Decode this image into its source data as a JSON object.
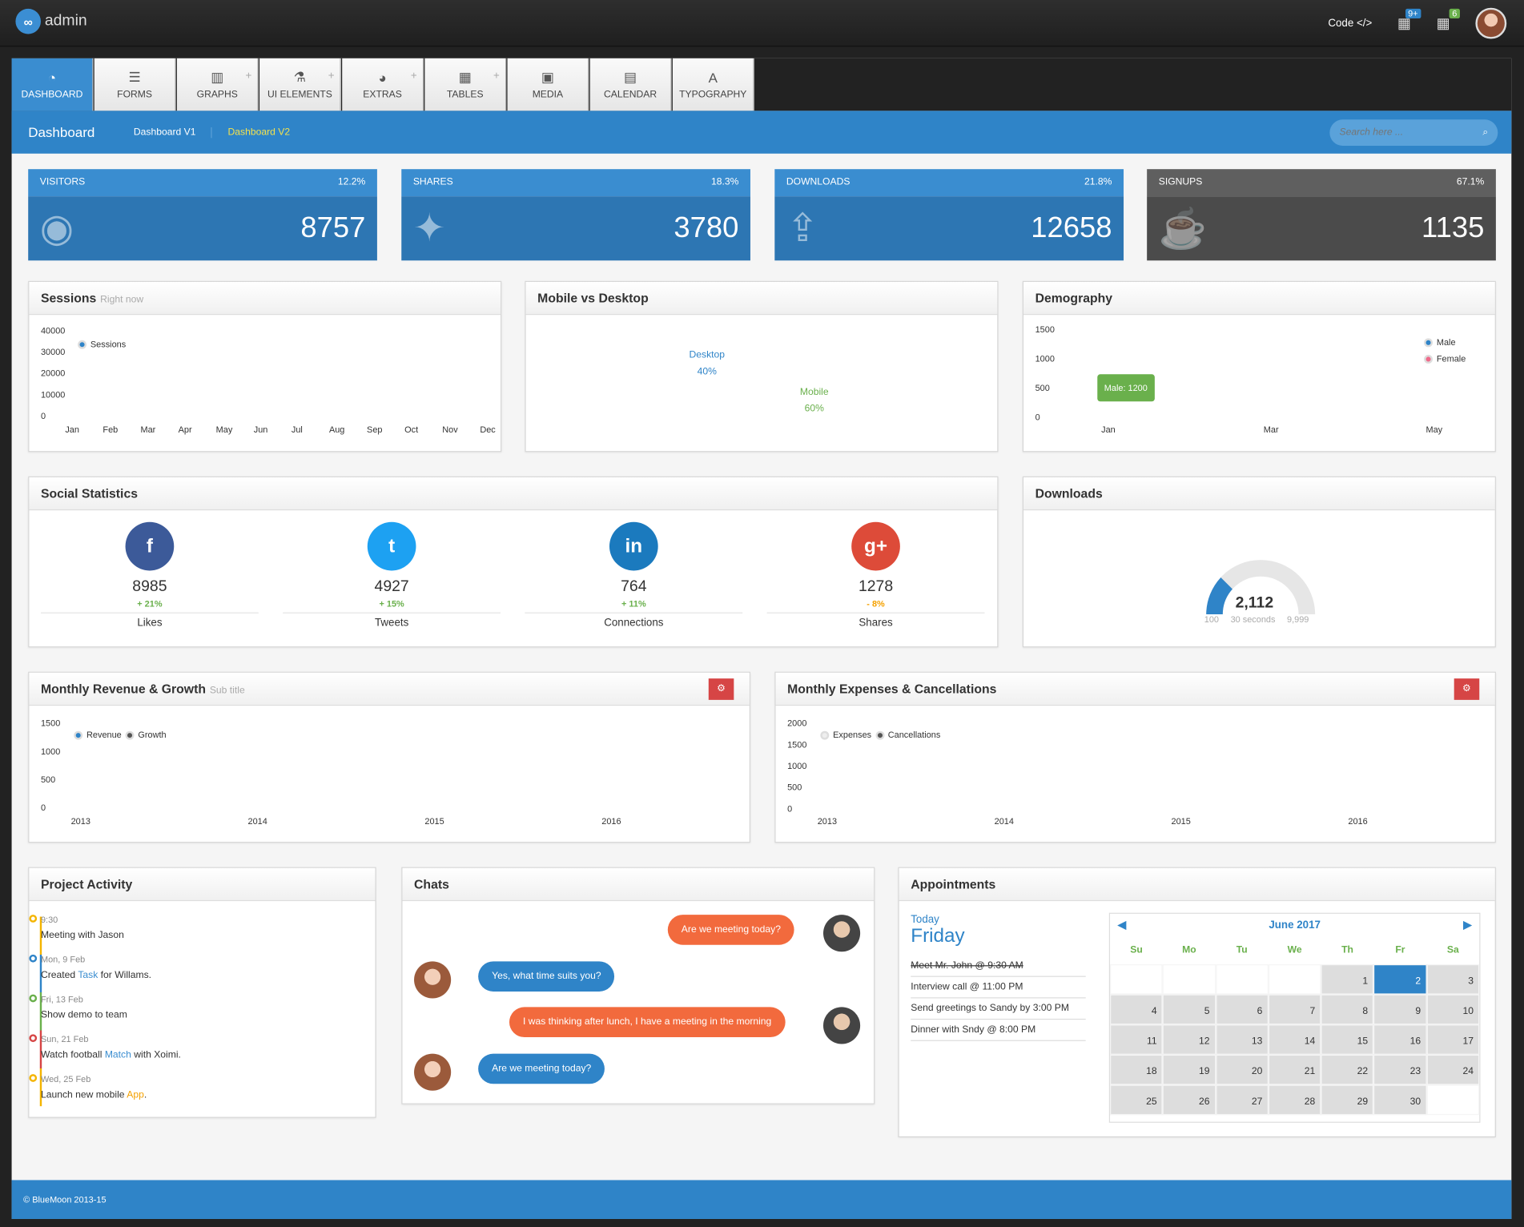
{
  "brand": {
    "name": "admin"
  },
  "topbar": {
    "code_label": "Code </>",
    "badge_1": "9+",
    "badge_2": "6"
  },
  "tabs": [
    {
      "label": "DASHBOARD",
      "icon": "dashboard-icon",
      "active": true
    },
    {
      "label": "FORMS",
      "icon": "list-icon"
    },
    {
      "label": "GRAPHS",
      "icon": "bar-chart-icon"
    },
    {
      "label": "UI ELEMENTS",
      "icon": "flask-icon"
    },
    {
      "label": "EXTRAS",
      "icon": "gauge-icon"
    },
    {
      "label": "TABLES",
      "icon": "table-icon"
    },
    {
      "label": "MEDIA",
      "icon": "image-icon"
    },
    {
      "label": "CALENDAR",
      "icon": "calendar-icon"
    },
    {
      "label": "TYPOGRAPHY",
      "icon": "font-icon"
    }
  ],
  "subbar": {
    "title": "Dashboard",
    "link_1": "Dashboard V1",
    "link_2": "Dashboard V2",
    "search_placeholder": "Search here ..."
  },
  "stats": [
    {
      "label": "VISITORS",
      "change": "12.2%",
      "value": "8757",
      "icon": "globe-icon"
    },
    {
      "label": "SHARES",
      "change": "18.3%",
      "value": "3780",
      "icon": "twitter-icon"
    },
    {
      "label": "DOWNLOADS",
      "change": "21.8%",
      "value": "12658",
      "icon": "upload-icon"
    },
    {
      "label": "SIGNUPS",
      "change": "67.1%",
      "value": "1135",
      "icon": "coffee-icon"
    }
  ],
  "sessions": {
    "title": "Sessions",
    "sub": "Right now",
    "legend": "Sessions",
    "y": [
      "40000",
      "30000",
      "20000",
      "10000",
      "0"
    ],
    "x": [
      "Jan",
      "Feb",
      "Mar",
      "Apr",
      "May",
      "Jun",
      "Jul",
      "Aug",
      "Sep",
      "Oct",
      "Nov",
      "Dec"
    ]
  },
  "mobile": {
    "title": "Mobile vs Desktop",
    "desktop": "Desktop",
    "desktop_pct": "40%",
    "mobile": "Mobile",
    "mobile_pct": "60%"
  },
  "demography": {
    "title": "Demography",
    "male": "Male",
    "female": "Female",
    "tooltip": "Male: 1200",
    "y": [
      "1500",
      "1000",
      "500",
      "0"
    ],
    "x": [
      "Jan",
      "Mar",
      "May"
    ]
  },
  "social": {
    "title": "Social Statistics",
    "items": [
      {
        "value": "8985",
        "pct": "+ 21%",
        "label": "Likes"
      },
      {
        "value": "4927",
        "pct": "+ 15%",
        "label": "Tweets"
      },
      {
        "value": "764",
        "pct": "+ 11%",
        "label": "Connections"
      },
      {
        "value": "1278",
        "pct": "- 8%",
        "label": "Shares"
      }
    ]
  },
  "downloads": {
    "title": "Downloads",
    "value": "2,112",
    "min": "100",
    "sub": "30 seconds",
    "max": "9,999"
  },
  "revenue": {
    "title": "Monthly Revenue & Growth",
    "sub": "Sub title",
    "l1": "Revenue",
    "l2": "Growth",
    "y": [
      "1500",
      "1000",
      "500",
      "0"
    ],
    "x": [
      "2013",
      "2014",
      "2015",
      "2016"
    ]
  },
  "expenses": {
    "title": "Monthly Expenses & Cancellations",
    "l1": "Expenses",
    "l2": "Cancellations",
    "y": [
      "2000",
      "1500",
      "1000",
      "500",
      "0"
    ],
    "x": [
      "2013",
      "2014",
      "2015",
      "2016"
    ]
  },
  "activity": {
    "title": "Project Activity",
    "items": [
      {
        "time": "9:30",
        "pre": "Meeting with Jason",
        "link": "",
        "post": ""
      },
      {
        "time": "Mon, 9 Feb",
        "pre": "Created ",
        "link": "Task",
        "post": " for Willams."
      },
      {
        "time": "Fri, 13 Feb",
        "pre": "Show demo to team",
        "link": "",
        "post": ""
      },
      {
        "time": "Sun, 21 Feb",
        "pre": "Watch football ",
        "link": "Match",
        "post": " with Xoimi."
      },
      {
        "time": "Wed, 25 Feb",
        "pre": "Launch new mobile ",
        "link": "App",
        "post": "."
      }
    ]
  },
  "chats": {
    "title": "Chats",
    "m1": "Are we meeting today?",
    "m2": "Yes, what time suits you?",
    "m3": "I was thinking after lunch, I have a meeting in the morning",
    "m4": "Are we meeting today?"
  },
  "appointments": {
    "title": "Appointments",
    "today": "Today",
    "day": "Friday",
    "items": [
      "Meet Mr. John @ 9:30 AM",
      "Interview call @ 11:00 PM",
      "Send greetings to Sandy by 3:00 PM",
      "Dinner with Sndy @ 8:00 PM"
    ]
  },
  "calendar": {
    "month": "June 2017",
    "days": [
      "Su",
      "Mo",
      "Tu",
      "We",
      "Th",
      "Fr",
      "Sa"
    ],
    "dates": [
      "",
      "",
      "",
      "",
      "1",
      "2",
      "3",
      "4",
      "5",
      "6",
      "7",
      "8",
      "9",
      "10",
      "11",
      "12",
      "13",
      "14",
      "15",
      "16",
      "17",
      "18",
      "19",
      "20",
      "21",
      "22",
      "23",
      "24",
      "25",
      "26",
      "27",
      "28",
      "29",
      "30",
      ""
    ]
  },
  "footer": "© BlueMoon 2013-15"
}
